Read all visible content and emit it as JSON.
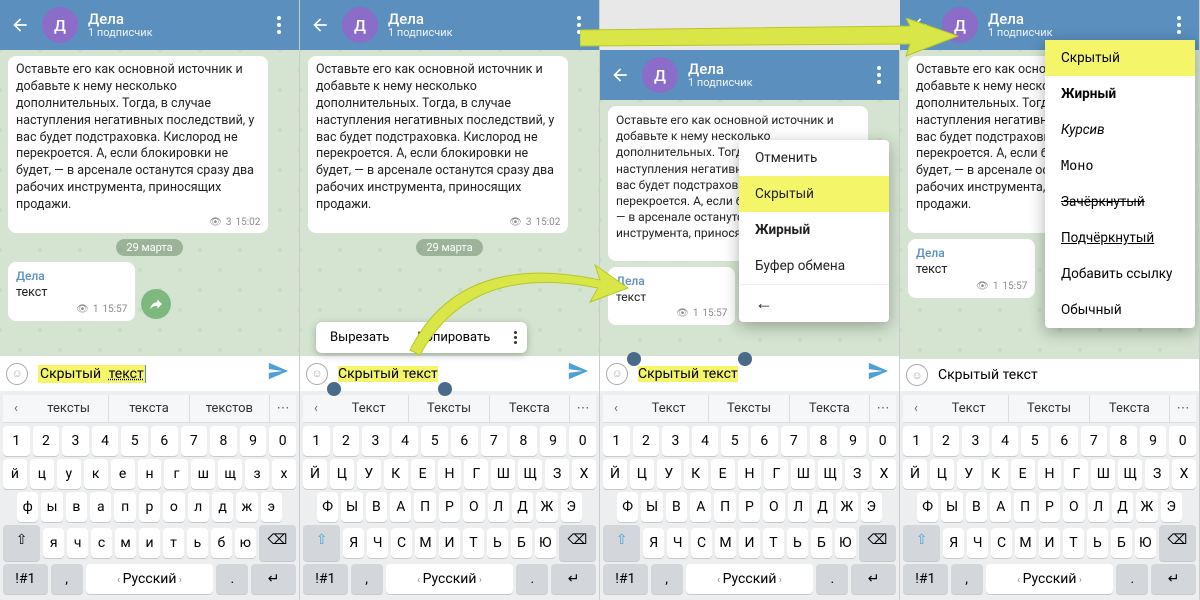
{
  "avatar_letter": "Д",
  "chat_title": "Дела",
  "chat_sub": "1 подписчик",
  "msg_body": "Оставьте его как основной источник и добавьте к нему несколько дополнительных. Тогда, в случае наступления негативных последствий, у вас будет подстраховка. Кислород не перекроется. А, если блокировки не будет, — в арсенале останутся сразу два рабочих инструмента, приносящих продажи.",
  "msg_views": "3",
  "msg_time": "15:02",
  "date_pill": "29 марта",
  "reply_author": "Дела",
  "reply_text": "текст",
  "reply_views": "1",
  "reply_time": "15:57",
  "input_text_plain": "Скрытый ",
  "input_text_spoiler": "текст",
  "ctx": {
    "cut": "Вырезать",
    "copy": "Копировать"
  },
  "menu3": {
    "cancel": "Отменить",
    "hidden": "Скрытый",
    "bold": "Жирный",
    "clipboard": "Буфер обмена"
  },
  "menu4": {
    "hidden": "Скрытый",
    "bold": "Жирный",
    "italic": "Курсив",
    "mono": "Моно",
    "strike": "Зачёркнутый",
    "under": "Подчёркнутый",
    "link": "Добавить ссылку",
    "plain": "Обычный"
  },
  "sugg1": [
    "тексты",
    "текста",
    "текстов"
  ],
  "sugg2": [
    "Текст",
    "Тексты",
    "Текста"
  ],
  "kb": {
    "nums": [
      "1",
      "2",
      "3",
      "4",
      "5",
      "6",
      "7",
      "8",
      "9",
      "0"
    ],
    "row1": [
      "й",
      "ц",
      "у",
      "к",
      "е",
      "н",
      "г",
      "ш",
      "щ",
      "з",
      "х"
    ],
    "row2": [
      "ф",
      "ы",
      "в",
      "а",
      "п",
      "р",
      "о",
      "л",
      "д",
      "ж",
      "э"
    ],
    "row3": [
      "я",
      "ч",
      "с",
      "м",
      "и",
      "т",
      "ь",
      "б",
      "ю"
    ],
    "sym": "!#1",
    "comma": ",",
    "lang": "Русский",
    "dot": "."
  },
  "kb_upper": {
    "row1": [
      "Й",
      "Ц",
      "У",
      "К",
      "Е",
      "Н",
      "Г",
      "Ш",
      "Щ",
      "З",
      "Х"
    ],
    "row2": [
      "Ф",
      "Ы",
      "В",
      "А",
      "П",
      "Р",
      "О",
      "Л",
      "Д",
      "Ж",
      "Э"
    ],
    "row3": [
      "Я",
      "Ч",
      "С",
      "М",
      "И",
      "Т",
      "Ь",
      "Б",
      "Ю"
    ]
  }
}
